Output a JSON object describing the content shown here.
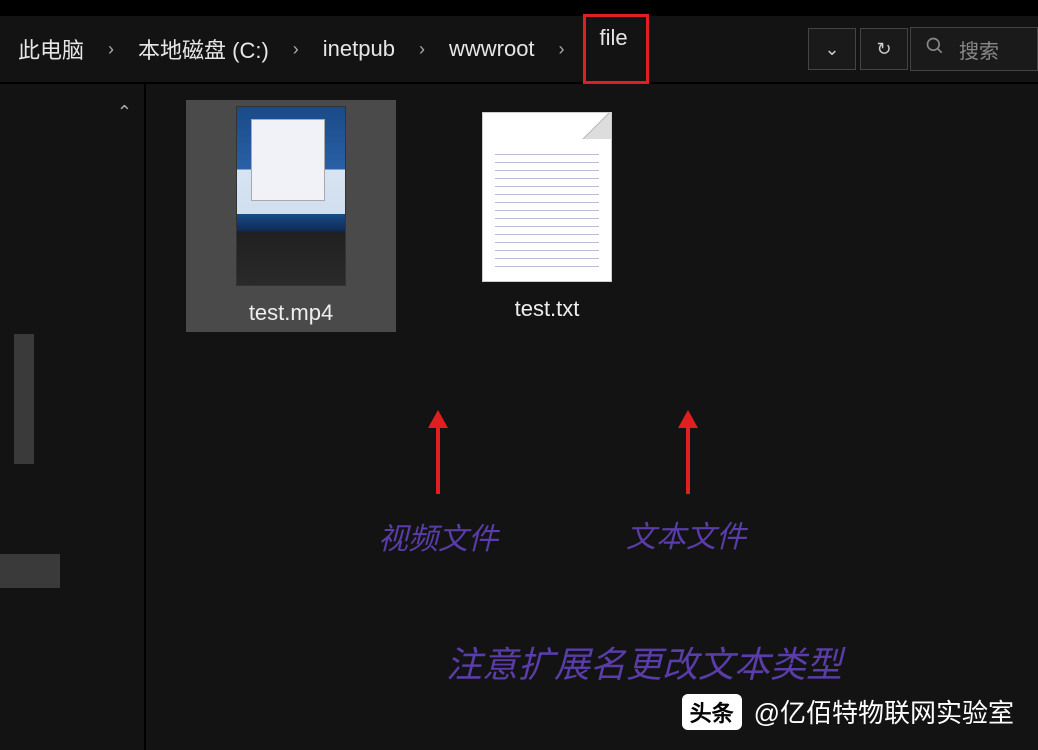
{
  "breadcrumb": {
    "items": [
      {
        "label": "此电脑"
      },
      {
        "label": "本地磁盘 (C:)"
      },
      {
        "label": "inetpub"
      },
      {
        "label": "wwwroot"
      },
      {
        "label": "file",
        "highlighted": true
      }
    ],
    "separator": "›"
  },
  "nav": {
    "dropdown_icon": "⌄",
    "refresh_icon": "↻"
  },
  "search": {
    "icon": "🔍",
    "placeholder": "搜索"
  },
  "left_panel": {
    "collapse_icon": "⌃"
  },
  "files": [
    {
      "name": "test.mp4",
      "type": "video",
      "selected": true
    },
    {
      "name": "test.txt",
      "type": "text",
      "selected": false
    }
  ],
  "annotations": {
    "video_label": "视频文件",
    "text_label": "文本文件",
    "note": "注意扩展名更改文本类型"
  },
  "watermark": {
    "logo": "头条",
    "author": "@亿佰特物联网实验室"
  }
}
